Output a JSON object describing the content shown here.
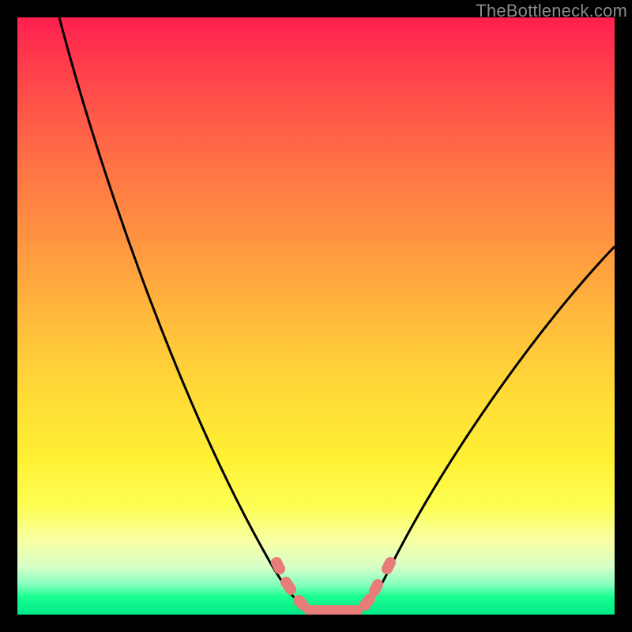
{
  "watermark": "TheBottleneck.com",
  "chart_data": {
    "type": "line",
    "title": "",
    "xlabel": "",
    "ylabel": "",
    "xlim": [
      0,
      100
    ],
    "ylim": [
      0,
      100
    ],
    "grid": false,
    "background_gradient": {
      "top": "#ff1f4e",
      "bottom": "#00e887"
    },
    "series": [
      {
        "name": "bottleneck-curve",
        "color": "#000000",
        "x": [
          7,
          10,
          14,
          18,
          22,
          26,
          30,
          34,
          38,
          41,
          43,
          45,
          48,
          52,
          56,
          58,
          60,
          62,
          66,
          72,
          78,
          84,
          90,
          96,
          100
        ],
        "y": [
          100,
          92,
          82,
          72,
          62,
          52,
          42,
          33,
          24,
          16,
          10,
          6,
          2,
          0,
          0,
          2,
          6,
          11,
          18,
          26,
          34,
          42,
          50,
          57,
          62
        ]
      },
      {
        "name": "markers",
        "color": "#e77d78",
        "type": "scatter",
        "x": [
          42,
          44,
          46,
          48,
          50,
          52,
          54,
          56,
          58,
          60,
          62
        ],
        "y": [
          9,
          5,
          2,
          0,
          0,
          0,
          0,
          0,
          3,
          7,
          12
        ]
      }
    ]
  }
}
